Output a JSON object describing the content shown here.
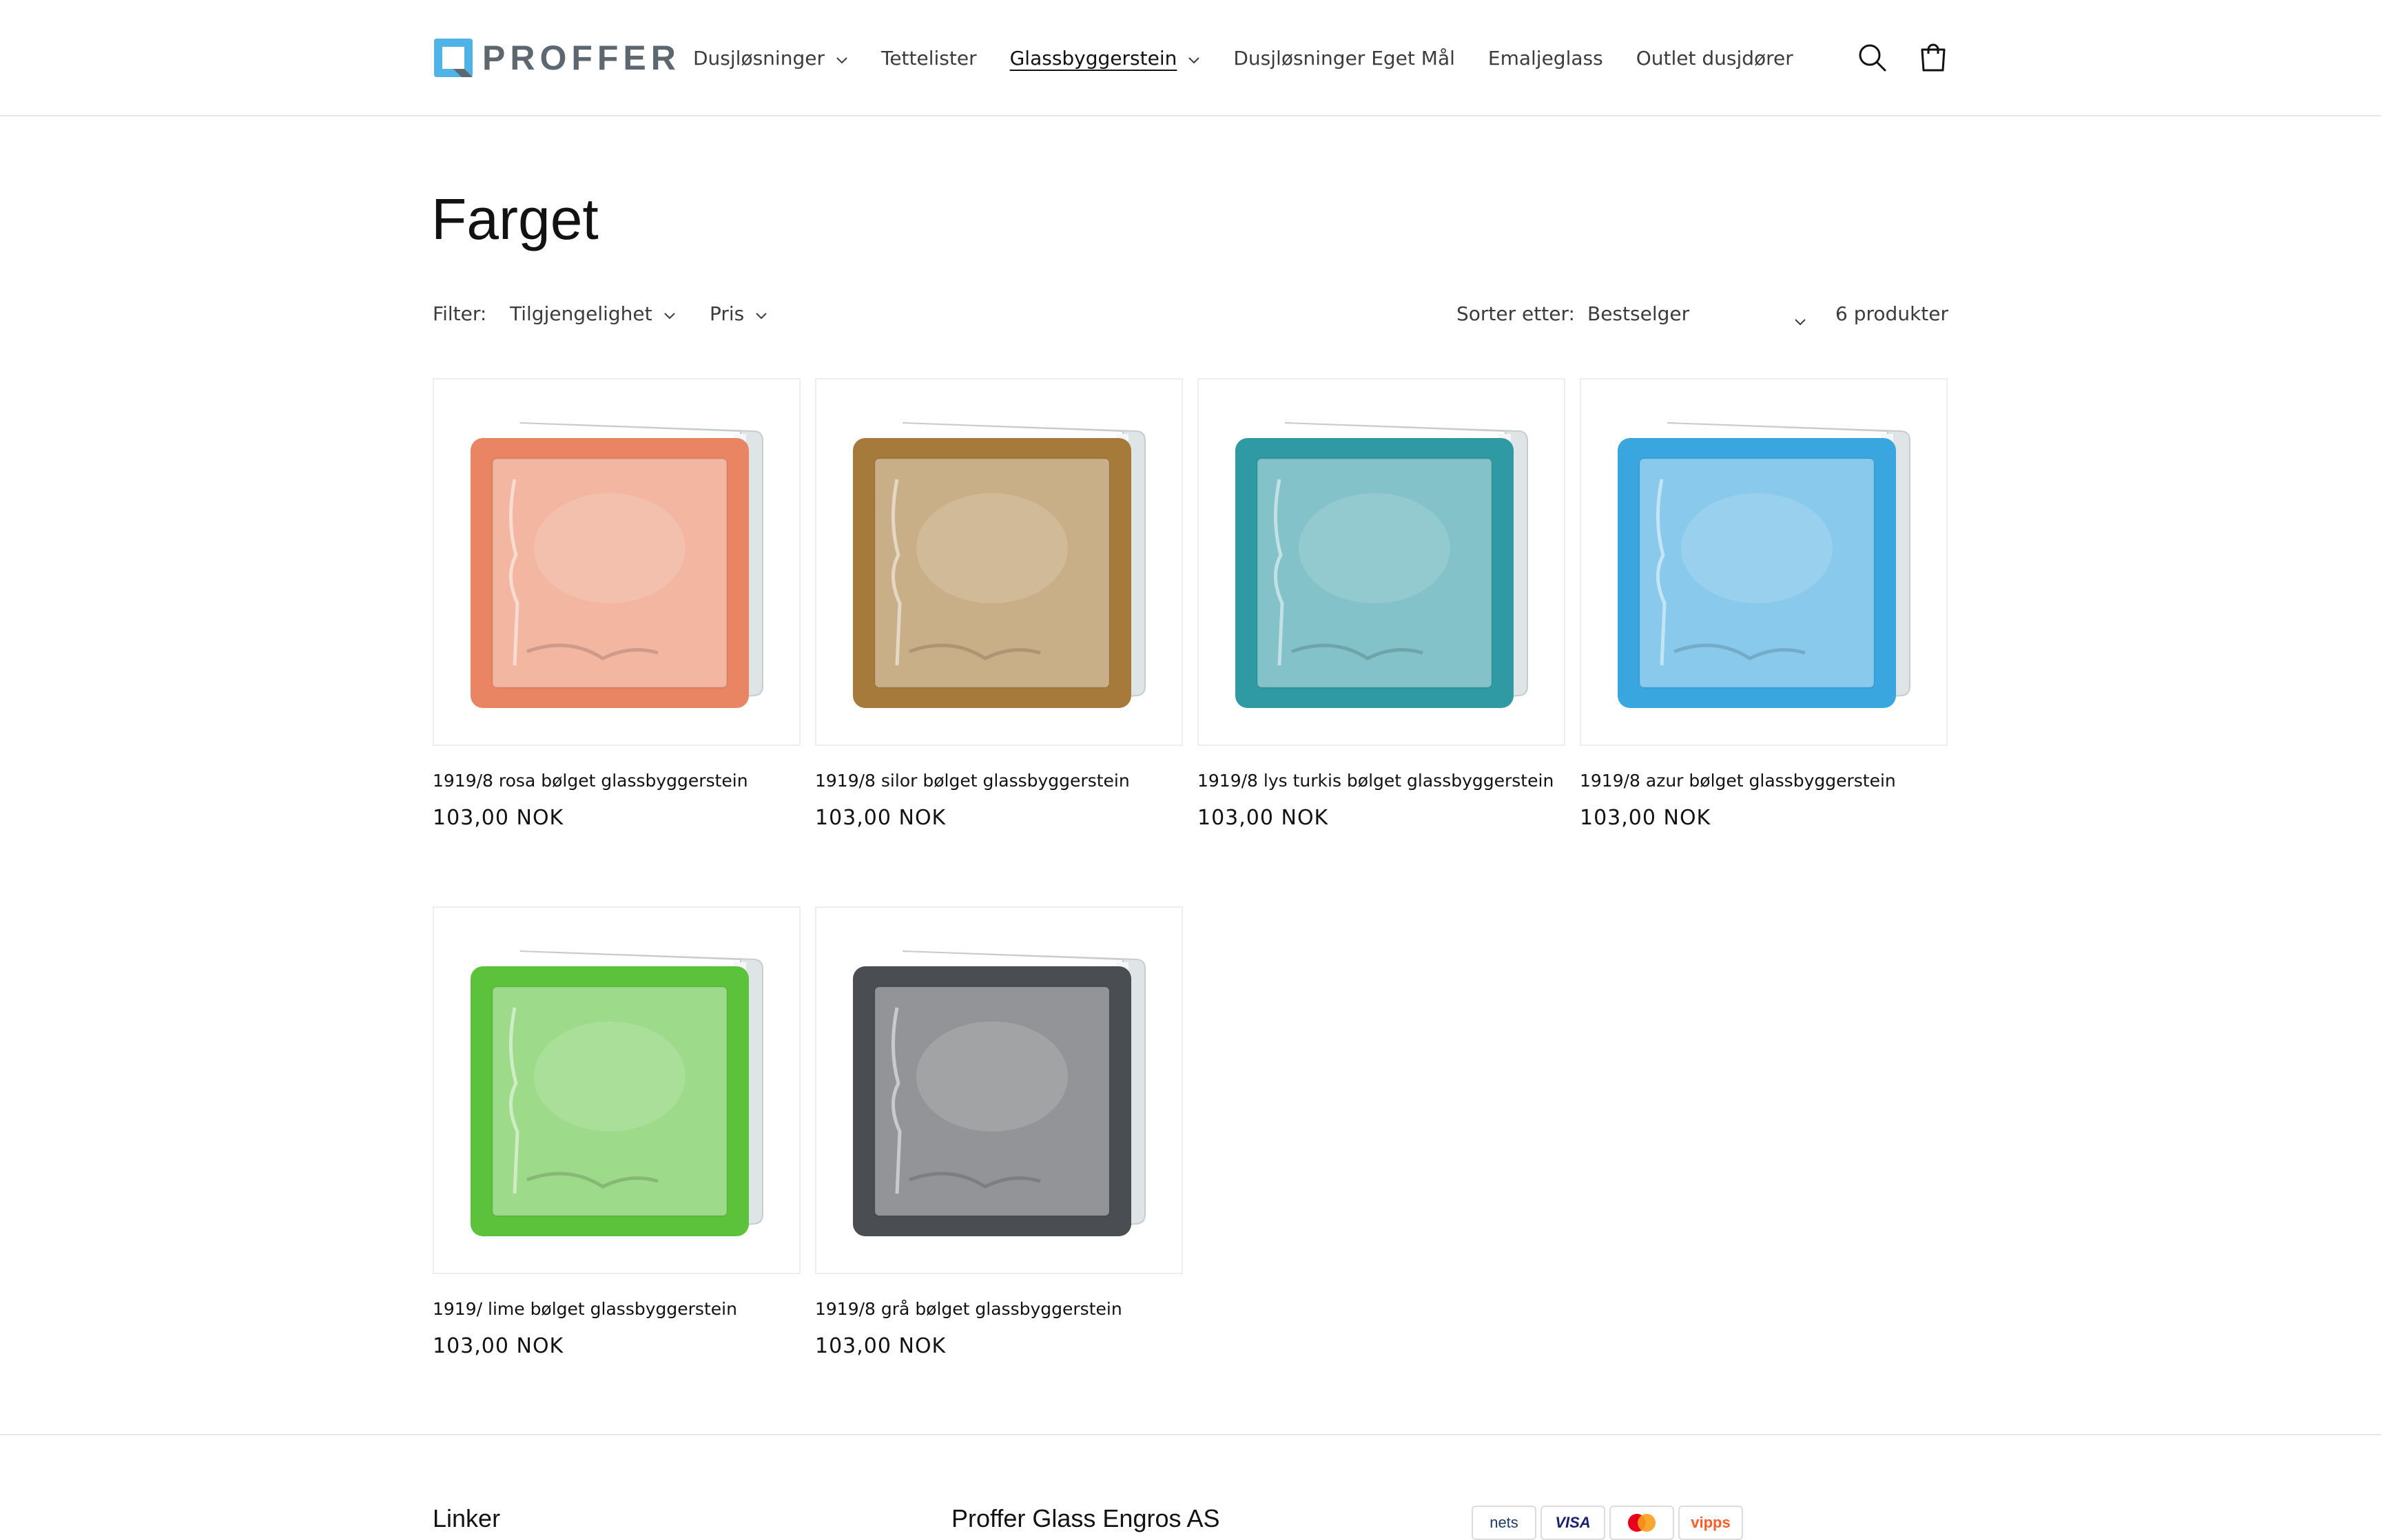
{
  "brand": {
    "name": "PROFFER"
  },
  "nav": {
    "items": [
      {
        "label": "Dusjløsninger",
        "dropdown": true,
        "active": false
      },
      {
        "label": "Tettelister",
        "dropdown": false,
        "active": false
      },
      {
        "label": "Glassbyggerstein",
        "dropdown": true,
        "active": true
      },
      {
        "label": "Dusjløsninger Eget Mål",
        "dropdown": false,
        "active": false
      },
      {
        "label": "Emaljeglass",
        "dropdown": false,
        "active": false
      },
      {
        "label": "Outlet dusjdører",
        "dropdown": false,
        "active": false
      }
    ]
  },
  "header_icons": [
    "search-icon",
    "cart-icon"
  ],
  "collection": {
    "title": "Farget",
    "filter_label": "Filter:",
    "filters": [
      "Tilgjengelighet",
      "Pris"
    ],
    "sort_label": "Sorter etter:",
    "sort_value": "Bestselger",
    "product_count": "6 produkter"
  },
  "products": [
    {
      "title": "1919/8 rosa bølget glassbyggerstein",
      "price": "103,00 NOK",
      "color": "#e98563"
    },
    {
      "title": "1919/8 silor bølget glassbyggerstein",
      "price": "103,00 NOK",
      "color": "#a67a3a"
    },
    {
      "title": "1919/8 lys turkis bølget glassbyggerstein",
      "price": "103,00 NOK",
      "color": "#2f9aa3"
    },
    {
      "title": "1919/8 azur bølget glassbyggerstein",
      "price": "103,00 NOK",
      "color": "#3aa6e0"
    },
    {
      "title": "1919/ lime bølget glassbyggerstein",
      "price": "103,00 NOK",
      "color": "#5cc23c"
    },
    {
      "title": "1919/8 grå bølget glassbyggerstein",
      "price": "103,00 NOK",
      "color": "#4a4e52"
    }
  ],
  "footer": {
    "headings": [
      "Linker",
      "Proffer Glass Engros AS"
    ],
    "payment_methods": [
      "nets",
      "VISA",
      "mastercard",
      "vipps"
    ]
  },
  "colors": {
    "brand_blue": "#4fb3e6",
    "brand_gray": "#5d6770"
  }
}
